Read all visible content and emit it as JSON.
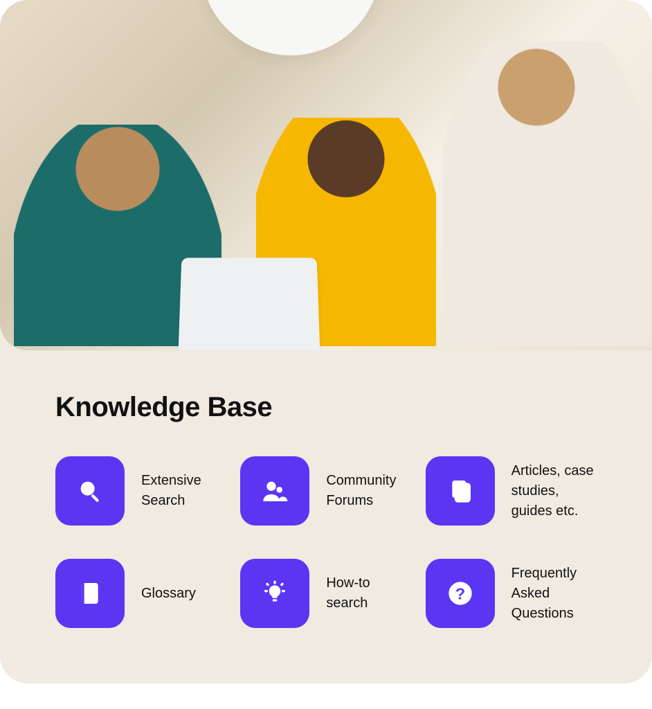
{
  "section": {
    "title": "Knowledge Base"
  },
  "colors": {
    "tile": "#5b35f2",
    "card_bg": "#f0eae0"
  },
  "features": [
    {
      "icon": "search-icon",
      "label": "Extensive Search"
    },
    {
      "icon": "people-icon",
      "label": "Community Forums"
    },
    {
      "icon": "documents-icon",
      "label": "Articles, case studies, guides etc."
    },
    {
      "icon": "book-icon",
      "label": "Glossary"
    },
    {
      "icon": "lightbulb-icon",
      "label": "How-to search"
    },
    {
      "icon": "question-icon",
      "label": "Frequently Asked Questions"
    }
  ]
}
